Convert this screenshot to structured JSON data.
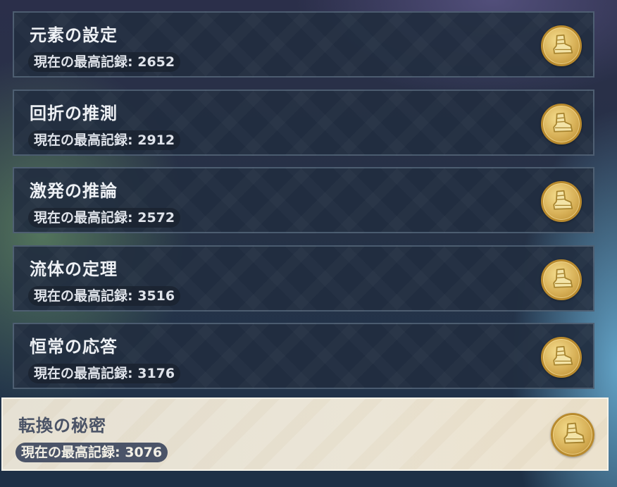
{
  "record_label": "現在の最高記録:",
  "theme": {
    "card_bg": "#212d3f",
    "selected_bg": "#e8e2d2",
    "badge_gold": "#d8b158"
  },
  "challenges": [
    {
      "title": "元素の設定",
      "record": "2652",
      "selected": false,
      "icon": "golden-boot-icon"
    },
    {
      "title": "回折の推測",
      "record": "2912",
      "selected": false,
      "icon": "golden-boot-icon"
    },
    {
      "title": "激発の推論",
      "record": "2572",
      "selected": false,
      "icon": "golden-boot-icon"
    },
    {
      "title": "流体の定理",
      "record": "3516",
      "selected": false,
      "icon": "golden-boot-icon"
    },
    {
      "title": "恒常の応答",
      "record": "3176",
      "selected": false,
      "icon": "golden-boot-icon"
    },
    {
      "title": "転換の秘密",
      "record": "3076",
      "selected": true,
      "icon": "golden-boot-icon"
    }
  ]
}
